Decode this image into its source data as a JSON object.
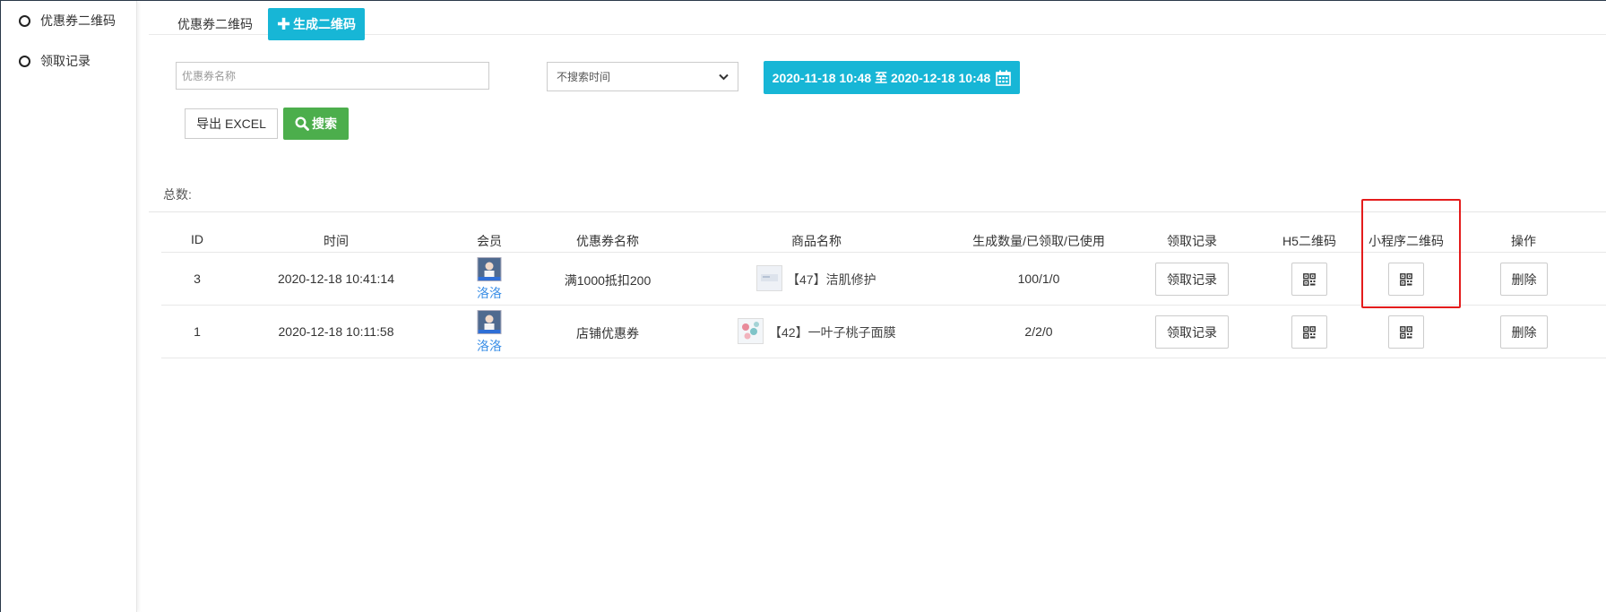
{
  "sidebar": {
    "items": [
      {
        "label": "优惠券二维码"
      },
      {
        "label": "领取记录"
      }
    ]
  },
  "header": {
    "tab_label": "优惠券二维码",
    "create_label": "生成二维码"
  },
  "filters": {
    "name_placeholder": "优惠券名称",
    "time_select_value": "不搜索时间",
    "date_range": "2020-11-18 10:48 至 2020-12-18 10:48",
    "export_label": "导出 EXCEL",
    "search_label": "搜索"
  },
  "summary": {
    "total_label": "总数:"
  },
  "table": {
    "columns": [
      "ID",
      "时间",
      "会员",
      "优惠券名称",
      "商品名称",
      "生成数量/已领取/已使用",
      "领取记录",
      "H5二维码",
      "小程序二维码",
      "操作"
    ],
    "rows": [
      {
        "id": "3",
        "time": "2020-12-18 10:41:14",
        "member": "洛洛",
        "coupon": "满1000抵扣200",
        "product": "【47】洁肌修护",
        "counts": "100/1/0",
        "record_btn": "领取记录",
        "delete_btn": "删除"
      },
      {
        "id": "1",
        "time": "2020-12-18 10:11:58",
        "member": "洛洛",
        "coupon": "店铺优惠券",
        "product": "【42】一叶子桃子面膜",
        "counts": "2/2/0",
        "record_btn": "领取记录",
        "delete_btn": "删除"
      }
    ]
  },
  "colors": {
    "accent_cyan": "#17b6d6",
    "search_green": "#4cae4c",
    "link_blue": "#3a8ee6",
    "highlight_red": "#e41c1c"
  }
}
